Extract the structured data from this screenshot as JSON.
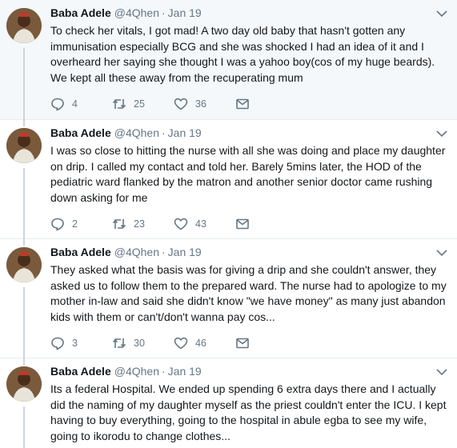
{
  "tweets": [
    {
      "name": "Baba Adele",
      "handle": "@4Qhen",
      "date": "Jan 19",
      "text": "To check her vitals, I got mad! A two day old baby that hasn't gotten any immunisation especially BCG and she was shocked I had an idea of it and I overheard her saying she thought I was a yahoo boy(cos of my huge beards). We kept all these away from the recuperating mum",
      "replies": "4",
      "retweets": "25",
      "likes": "36"
    },
    {
      "name": "Baba Adele",
      "handle": "@4Qhen",
      "date": "Jan 19",
      "text": "I was so close to hitting the nurse with all she was doing and place my daughter on drip. I called my contact and told her. Barely 5mins later, the HOD of the pediatric ward flanked by the matron and another senior doctor came rushing down asking for me",
      "replies": "2",
      "retweets": "23",
      "likes": "43"
    },
    {
      "name": "Baba Adele",
      "handle": "@4Qhen",
      "date": "Jan 19",
      "text": "They asked what the basis was for giving a drip and she couldn't answer, they asked us to follow them to the prepared ward. The nurse had to apologize to my mother in-law and said she didn't know \"we have money\" as many just abandon kids with them or can't/don't wanna pay cos...",
      "replies": "3",
      "retweets": "30",
      "likes": "46"
    },
    {
      "name": "Baba Adele",
      "handle": "@4Qhen",
      "date": "Jan 19",
      "text": "Its a federal Hospital. We ended up spending 6 extra days there and I actually did the naming of my daughter myself as the priest couldn't enter the ICU. I kept having to buy everything, going to the hospital in abule egba to see my wife, going to ikorodu to change clothes..."
    }
  ],
  "colors": {
    "text": "#14171a",
    "secondary": "#657786",
    "highlight_bg": "#f5f8fa",
    "divider": "#e6ecf0",
    "thread_line": "#ccd6dd"
  },
  "icons": {
    "reply": "reply-icon",
    "retweet": "retweet-icon",
    "like": "heart-icon",
    "dm": "envelope-icon",
    "more": "chevron-down-icon"
  }
}
